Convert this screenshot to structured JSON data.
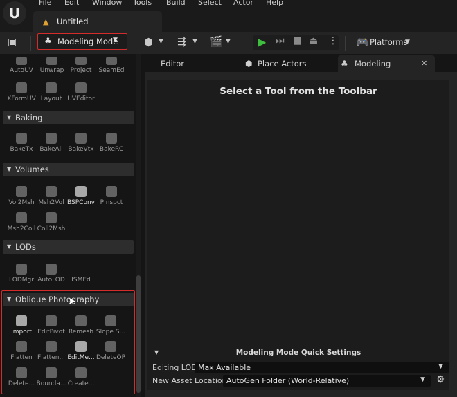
{
  "menu": [
    "File",
    "Edit",
    "Window",
    "Tools",
    "Build",
    "Select",
    "Actor",
    "Help"
  ],
  "doc_tab": {
    "title": "Untitled"
  },
  "toolbar": {
    "mode_label": "Modeling Mode",
    "platforms_label": "Platforms"
  },
  "tool_categories": [
    {
      "title": "",
      "tools": [
        "AutoUV",
        "Unwrap",
        "Project",
        "SeamEd",
        "XFormUV",
        "Layout",
        "UVEditor"
      ]
    },
    {
      "title": "Baking",
      "tools": [
        "BakeTx",
        "BakeAll",
        "BakeVtx",
        "BakeRC"
      ]
    },
    {
      "title": "Volumes",
      "tools": [
        "Vol2Msh",
        "Msh2Vol",
        "BSPConv",
        "PInspct",
        "Msh2Coll",
        "Coll2Msh"
      ]
    },
    {
      "title": "LODs",
      "tools": [
        "LODMgr",
        "AutoLOD",
        "ISMEd"
      ]
    },
    {
      "title": "Oblique Photography",
      "tools": [
        "Import",
        "EditPivot",
        "Remesh",
        "Slope S...",
        "Flatten",
        "Flatten...",
        "EditMe...",
        "DeleteOP",
        "Delete...",
        "Bounda...",
        "Create..."
      ]
    }
  ],
  "editor_tabs": [
    "Editor",
    "Place Actors",
    "Modeling"
  ],
  "main": {
    "prompt": "Select a Tool from the Toolbar"
  },
  "quick_settings": {
    "title": "Modeling Mode Quick Settings",
    "editing_lod": {
      "label": "Editing LOD",
      "value": "Max Available"
    },
    "new_asset_location": {
      "label": "New Asset Location",
      "value": "AutoGen Folder (World-Relative)"
    }
  }
}
